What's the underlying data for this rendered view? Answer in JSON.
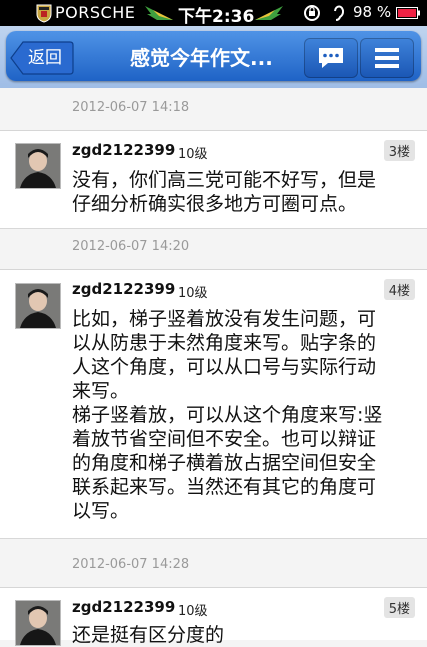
{
  "status_bar": {
    "carrier": "PORSCHE",
    "time": "下午2:36",
    "battery": "98 %",
    "icons": [
      "porsche-crest-icon",
      "wing-left-icon",
      "wing-right-icon",
      "rotation-lock-icon",
      "hearing-icon",
      "battery-icon"
    ]
  },
  "nav": {
    "back_label": "返回",
    "title": "感觉今年作文...",
    "buttons": [
      "comment-icon",
      "menu-icon"
    ]
  },
  "posts": [
    {
      "time": "2012-06-07 14:18"
    },
    {
      "username": "zgd2122399",
      "level": "10级",
      "floor": "3楼",
      "content": "没有，你们高三党可能不好写，但是\n仔细分析确实很多地方可圈可点。",
      "time": "2012-06-07 14:20"
    },
    {
      "username": "zgd2122399",
      "level": "10级",
      "floor": "4楼",
      "content": "比如，梯子竖着放没有发生问题，可\n以从防患于未然角度来写。贴字条的\n人这个角度，可以从口号与实际行动\n来写。\n梯子竖着放，可以从这个角度来写:竖\n着放节省空间但不安全。也可以辩证\n的角度和梯子横着放占据空间但安全\n联系起来写。当然还有其它的角度可\n以写。",
      "time": "2012-06-07 14:28"
    },
    {
      "username": "zgd2122399",
      "level": "10级",
      "floor": "5楼",
      "content": "还是挺有区分度的"
    }
  ]
}
